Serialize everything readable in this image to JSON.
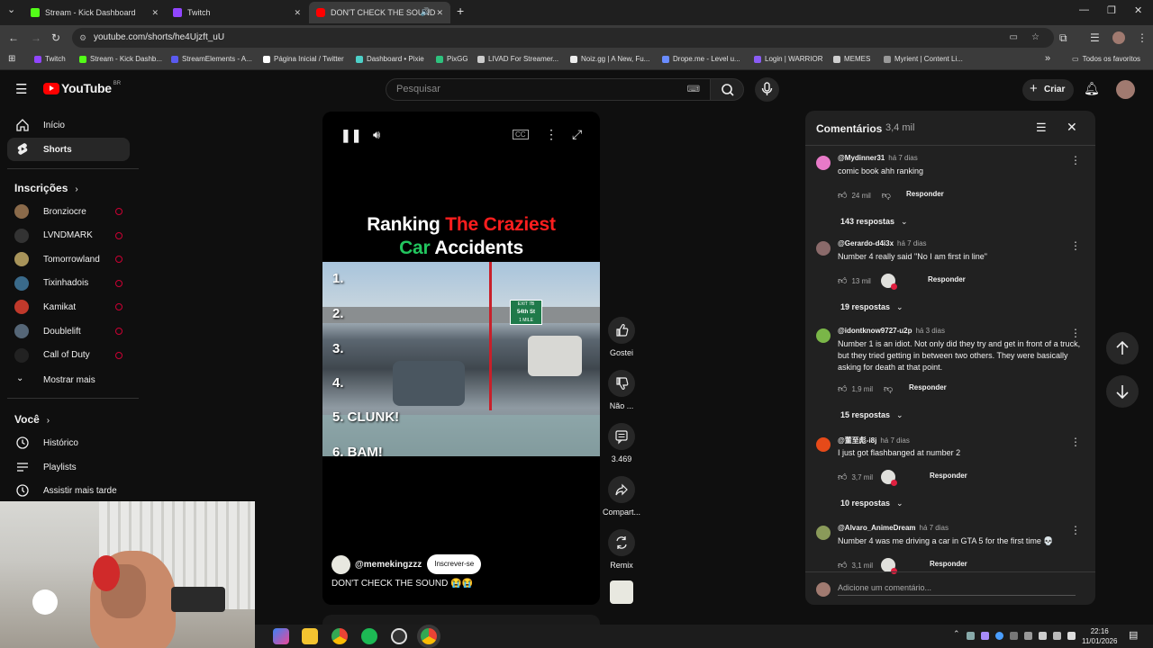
{
  "browser": {
    "tabs": [
      {
        "title": "Stream - Kick Dashboard",
        "color": "#53fc18"
      },
      {
        "title": "Twitch",
        "color": "#9146ff"
      },
      {
        "title": "DON'T CHECK THE SOUND",
        "color": "#ff0000"
      }
    ],
    "new_tab": "+",
    "url": "youtube.com/shorts/he4Ujzft_uU",
    "bookmarks": [
      {
        "label": "Twitch",
        "color": "#9146ff"
      },
      {
        "label": "Stream - Kick Dashb...",
        "color": "#53fc18"
      },
      {
        "label": "StreamElements - A...",
        "color": "#5a5af0"
      },
      {
        "label": "Página Inicial / Twitter",
        "color": "#ffffff"
      },
      {
        "label": "Dashboard • Pixie",
        "color": "#4dd0c8"
      },
      {
        "label": "PixGG",
        "color": "#2ec27e"
      },
      {
        "label": "LIVAD For Streamer...",
        "color": "#cccccc"
      },
      {
        "label": "Noiz.gg | A New, Fu...",
        "color": "#eeeeee"
      },
      {
        "label": "Drope.me - Level u...",
        "color": "#6a8cff"
      },
      {
        "label": "Login | WARRIOR",
        "color": "#8a5cf5"
      },
      {
        "label": "MEMES",
        "color": "#cfcfcf"
      },
      {
        "label": "Myrient | Content Li...",
        "color": "#999999"
      }
    ],
    "bookmarks_overflow": "»",
    "all_favorites": "Todos os favoritos"
  },
  "youtube": {
    "logo": "YouTube",
    "region": "BR",
    "search_placeholder": "Pesquisar",
    "create_label": "Criar"
  },
  "sidebar": {
    "main": [
      {
        "label": "Início",
        "icon": "home-icon"
      },
      {
        "label": "Shorts",
        "icon": "shorts-icon"
      }
    ],
    "subscriptions_title": "Inscrições",
    "subscriptions": [
      {
        "name": "Bronziocre",
        "color": "#8a6a4a"
      },
      {
        "name": "LVNDMARK",
        "color": "#333333"
      },
      {
        "name": "Tomorrowland",
        "color": "#a8945a"
      },
      {
        "name": "Tixinhadois",
        "color": "#3a6a8a"
      },
      {
        "name": "Kamikat",
        "color": "#c0392b"
      },
      {
        "name": "Doublelift",
        "color": "#556677"
      },
      {
        "name": "Call of Duty",
        "color": "#222222"
      }
    ],
    "show_more": "Mostrar mais",
    "you_title": "Você",
    "you_items": [
      {
        "label": "Histórico",
        "icon": "history-icon"
      },
      {
        "label": "Playlists",
        "icon": "playlists-icon"
      },
      {
        "label": "Assistir mais tarde",
        "icon": "watch-later-icon"
      }
    ]
  },
  "short": {
    "title_line1_white": "Ranking ",
    "title_line1_red": "The Craziest",
    "title_line2_green": "Car",
    "title_line2_white": " Accidents",
    "ranks": [
      "1.",
      "2.",
      "3.",
      "4.",
      "5. CLUNK!",
      "6. BAM!"
    ],
    "sign_exit": "EXIT 7B",
    "sign_street": "54th St",
    "sign_distance": "1 MILE",
    "channel": "@memekingzzz",
    "subscribe": "Inscrever-se",
    "caption": "DON'T CHECK THE SOUND 😭😭"
  },
  "actions": {
    "like": "Gostei",
    "dislike": "Não ...",
    "comments": "3.469",
    "share": "Compart...",
    "remix": "Remix"
  },
  "comments": {
    "title": "Comentários",
    "count": "3,4 mil",
    "reply_label": "Responder",
    "add_placeholder": "Adicione um comentário...",
    "items": [
      {
        "author": "@Mydinner31",
        "time": "há 7 dias",
        "text": "comic book ahh ranking",
        "likes": "24 mil",
        "replies": "143 respostas",
        "color": "#e87ac8",
        "creator_heart": false
      },
      {
        "author": "@Gerardo-d4i3x",
        "time": "há 7 dias",
        "text": "Number 4 really said \"No I am first in line\"",
        "likes": "13 mil",
        "replies": "19 respostas",
        "color": "#8a6a6a",
        "creator_heart": true
      },
      {
        "author": "@idontknow9727-u2p",
        "time": "há 3 dias",
        "text": "Number 1 is an idiot. Not only did they try and get in front of a truck, but they tried getting in between two others. They were basically asking for death at that point.",
        "likes": "1,9 mil",
        "replies": "15 respostas",
        "color": "#7ab648",
        "creator_heart": false
      },
      {
        "author": "@董至彪-i8j",
        "time": "há 7 dias",
        "text": "I just got flashbanged at number 2",
        "likes": "3,7 mil",
        "replies": "10 respostas",
        "color": "#e64a19",
        "creator_heart": true
      },
      {
        "author": "@Alvaro_AnimeDream",
        "time": "há 7 dias",
        "text": "Number 4 was me driving a car in GTA 5 for the first time 💀",
        "likes": "3,1 mil",
        "replies": "",
        "color": "#8a9a5a",
        "creator_heart": true
      }
    ]
  },
  "taskbar": {
    "time": "22:16",
    "date": "11/01/2026"
  }
}
